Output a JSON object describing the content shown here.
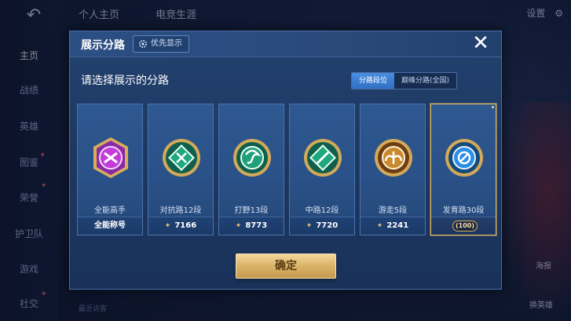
{
  "background": {
    "nav": [
      "主页",
      "战绩",
      "英雄",
      "图鉴",
      "荣誉",
      "护卫队",
      "游戏",
      "社交"
    ],
    "top_tabs": [
      "个人主页",
      "电竞生涯"
    ],
    "top_right": "设置",
    "right_labels": [
      "海报",
      "换英雄"
    ],
    "bottom_text": "最近访客"
  },
  "modal": {
    "title": "展示分路",
    "priority_label": "优先显示",
    "subtitle": "请选择展示的分路",
    "segments": [
      {
        "label": "分路段位",
        "active": true
      },
      {
        "label": "巅峰分路(全国)",
        "active": false
      }
    ],
    "cards": [
      {
        "name": "全能高手",
        "footer": "全能称号",
        "badge_color": "#c43bd8",
        "badge_icon": "all-round-icon",
        "has_star": false,
        "selected": false
      },
      {
        "name": "对抗路12段",
        "footer": "7166",
        "badge_color": "#1fa77d",
        "badge_icon": "clash-lane-icon",
        "has_star": true,
        "selected": false
      },
      {
        "name": "打野13段",
        "footer": "8773",
        "badge_color": "#1f9f7a",
        "badge_icon": "jungle-dragon-icon",
        "has_star": true,
        "selected": false
      },
      {
        "name": "中路12段",
        "footer": "7720",
        "badge_color": "#1fa77d",
        "badge_icon": "mid-lane-icon",
        "has_star": true,
        "selected": false
      },
      {
        "name": "游走5段",
        "footer": "2241",
        "badge_color": "#c98a2e",
        "badge_icon": "roam-wings-icon",
        "has_star": true,
        "selected": false
      },
      {
        "name": "发育路30段",
        "footer": "100",
        "badge_color": "#2a8ee6",
        "badge_icon": "farm-lane-icon",
        "has_star": false,
        "selected": true
      }
    ],
    "confirm_label": "确定"
  }
}
